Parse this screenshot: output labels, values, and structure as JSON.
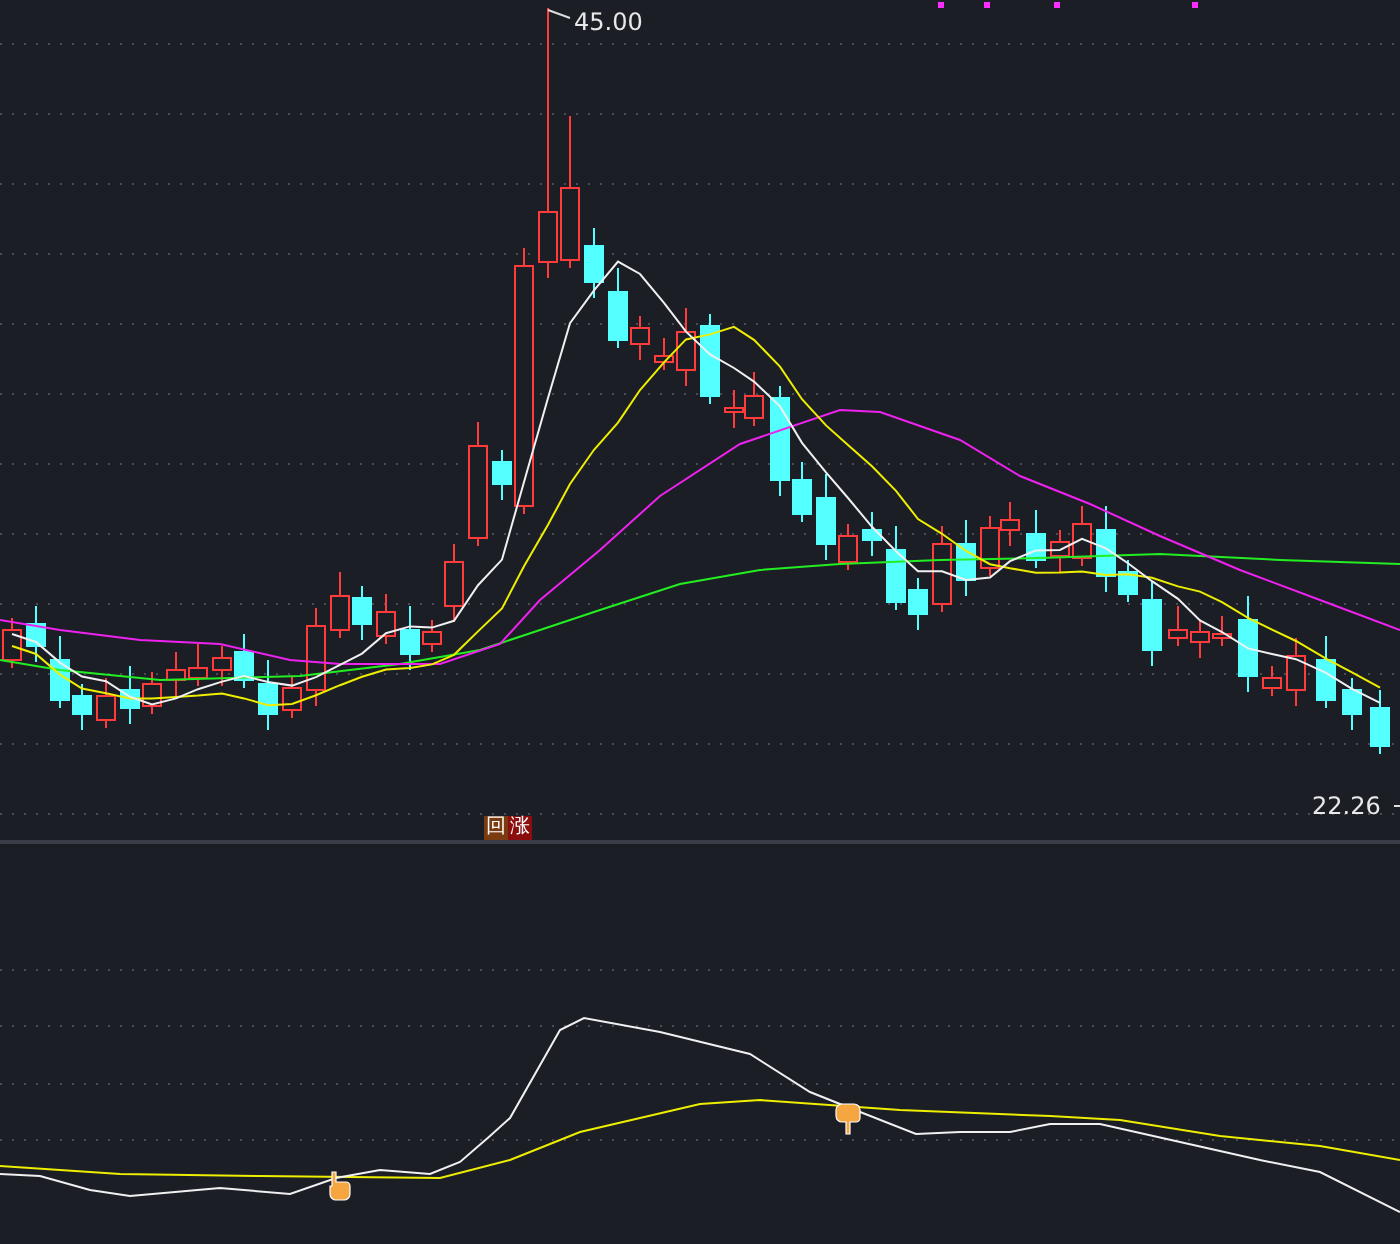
{
  "price_panel": {
    "high_label": "45.00",
    "low_label": "22.26",
    "signal_badge": [
      {
        "text": "回",
        "color": "#7a3b10"
      },
      {
        "text": "涨",
        "color": "#8b0d0d"
      }
    ]
  }
}
